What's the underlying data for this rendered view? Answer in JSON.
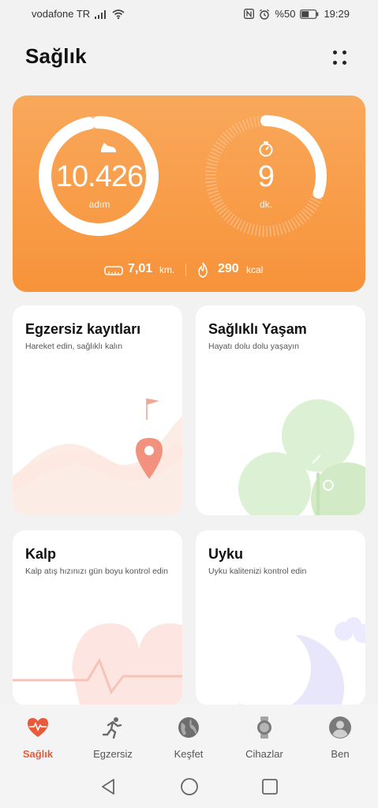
{
  "status_bar": {
    "carrier": "vodafone TR",
    "battery": "%50",
    "time": "19:29",
    "icons": [
      "signal-icon",
      "wifi-icon",
      "nfc-icon",
      "alarm-icon",
      "battery-icon"
    ]
  },
  "header": {
    "title": "Sağlık",
    "more_icon": "more-dots-icon"
  },
  "activity": {
    "steps_value": "10.426",
    "steps_unit": "adım",
    "steps_progress": 0.97,
    "minutes_value": "9",
    "minutes_unit": "dk.",
    "minutes_progress": 0.3,
    "distance_value": "7,01",
    "distance_unit": "km.",
    "calories_value": "290",
    "calories_unit": "kcal",
    "colors": {
      "card": "#f7933a",
      "ring": "#ffffff"
    }
  },
  "cards": [
    {
      "title": "Egzersiz kayıtları",
      "subtitle": "Hareket edin, sağlıklı kalın"
    },
    {
      "title": "Sağlıklı Yaşam",
      "subtitle": "Hayatı dolu dolu yaşayın"
    },
    {
      "title": "Kalp",
      "subtitle": "Kalp atış hızınızı gün boyu kontrol edin"
    },
    {
      "title": "Uyku",
      "subtitle": "Uyku kalitenizi kontrol edin"
    }
  ],
  "bottom_nav": [
    {
      "label": "Sağlık",
      "icon": "heart-pulse-icon",
      "active": true
    },
    {
      "label": "Egzersiz",
      "icon": "runner-icon",
      "active": false
    },
    {
      "label": "Keşfet",
      "icon": "globe-icon",
      "active": false
    },
    {
      "label": "Cihazlar",
      "icon": "watch-icon",
      "active": false
    },
    {
      "label": "Ben",
      "icon": "profile-icon",
      "active": false
    }
  ],
  "accent_color": "#e85a3a",
  "system_nav": [
    "back-icon",
    "home-icon",
    "recents-icon"
  ]
}
